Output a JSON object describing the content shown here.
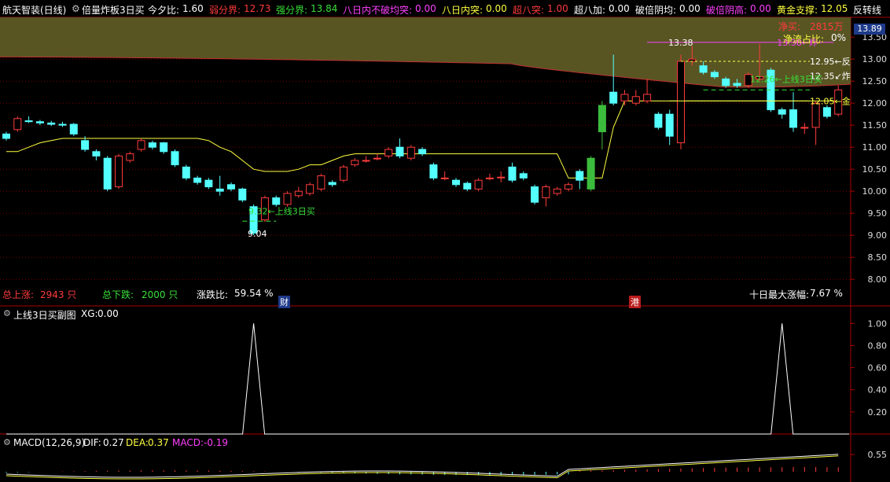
{
  "header": {
    "title": "航天智装(日线)",
    "indicator": "倍量炸板3日买",
    "items": [
      {
        "label": "今夕比:",
        "value": "1.60",
        "color": "#ffffff"
      },
      {
        "label": "弱分界:",
        "value": "12.73",
        "color": "#ff3b3b"
      },
      {
        "label": "强分界:",
        "value": "13.84",
        "color": "#38e038"
      },
      {
        "label": "八日内不破均突:",
        "value": "0.00",
        "color": "#ff40ff"
      },
      {
        "label": "八日内突:",
        "value": "0.00",
        "color": "#ffff40"
      },
      {
        "label": "超八突:",
        "value": "1.00",
        "color": "#ff3b3b"
      },
      {
        "label": "超八加:",
        "value": "0.00",
        "color": "#ffffff"
      },
      {
        "label": "破倍阴均:",
        "value": "0.00",
        "color": "#ffffff"
      },
      {
        "label": "破倍阴高:",
        "value": "0.00",
        "color": "#ff40ff"
      },
      {
        "label": "黄金支撑:",
        "value": "12.05",
        "color": "#ffff40"
      },
      {
        "label": "反转线",
        "value": "",
        "color": "#ffffff"
      }
    ]
  },
  "main_panel": {
    "net_buy_label": "净买:",
    "net_buy_value": "2815万",
    "net_flow_label": "净流占比:",
    "net_flow_value": "0%",
    "current_price_box": "13.89",
    "total_up_label": "总上涨:",
    "total_up_value": "2943 只",
    "total_down_label": "总下跌:",
    "total_down_value": "2000 只",
    "ratio_label": "涨跌比:",
    "ratio_value": "59.54 %",
    "ten_day_label": "十日最大涨幅:",
    "ten_day_value": "7.67 %",
    "marker_cai": "财",
    "marker_gang": "港"
  },
  "sub_panel": {
    "title": "上线3日买副图",
    "xg_label": "XG:",
    "xg_value": "0.00"
  },
  "macd_panel": {
    "title": "MACD(12,26,9)",
    "dif_label": "DIF:",
    "dif_value": "0.27",
    "dea_label": "DEA:",
    "dea_value": "0.37",
    "macd_label": "MACD:",
    "macd_value": "-0.19"
  },
  "chart_data": {
    "type": "candlestick",
    "y_ticks": [
      "13.50",
      "13.00",
      "12.50",
      "12.00",
      "11.50",
      "11.00",
      "10.50",
      "10.00",
      "9.50",
      "9.00",
      "8.50",
      "8.00"
    ],
    "ylim": [
      7.7,
      13.95
    ],
    "candles": [
      {
        "o": 11.3,
        "c": 11.2,
        "h": 11.35,
        "l": 11.15
      },
      {
        "o": 11.4,
        "c": 11.65,
        "h": 11.7,
        "l": 11.35
      },
      {
        "o": 11.6,
        "c": 11.58,
        "h": 11.7,
        "l": 11.55
      },
      {
        "o": 11.58,
        "c": 11.55,
        "h": 11.62,
        "l": 11.5
      },
      {
        "o": 11.55,
        "c": 11.52,
        "h": 11.6,
        "l": 11.48
      },
      {
        "o": 11.52,
        "c": 11.5,
        "h": 11.58,
        "l": 11.46
      },
      {
        "o": 11.52,
        "c": 11.3,
        "h": 11.55,
        "l": 11.25
      },
      {
        "o": 11.15,
        "c": 10.95,
        "h": 11.25,
        "l": 10.9
      },
      {
        "o": 10.9,
        "c": 10.8,
        "h": 10.95,
        "l": 10.7
      },
      {
        "o": 10.75,
        "c": 10.05,
        "h": 10.8,
        "l": 10.0
      },
      {
        "o": 10.1,
        "c": 10.8,
        "h": 10.85,
        "l": 10.05
      },
      {
        "o": 10.7,
        "c": 10.85,
        "h": 10.9,
        "l": 10.65
      },
      {
        "o": 10.95,
        "c": 11.15,
        "h": 11.2,
        "l": 10.9
      },
      {
        "o": 11.1,
        "c": 11.0,
        "h": 11.15,
        "l": 10.95
      },
      {
        "o": 11.1,
        "c": 10.9,
        "h": 11.12,
        "l": 10.85
      },
      {
        "o": 10.9,
        "c": 10.6,
        "h": 10.95,
        "l": 10.55
      },
      {
        "o": 10.55,
        "c": 10.3,
        "h": 10.6,
        "l": 10.25
      },
      {
        "o": 10.3,
        "c": 10.2,
        "h": 10.35,
        "l": 10.15
      },
      {
        "o": 10.25,
        "c": 10.1,
        "h": 10.3,
        "l": 10.05
      },
      {
        "o": 10.05,
        "c": 10.0,
        "h": 10.35,
        "l": 9.9
      },
      {
        "o": 10.15,
        "c": 10.05,
        "h": 10.2,
        "l": 10.0
      },
      {
        "o": 10.05,
        "c": 9.8,
        "h": 10.08,
        "l": 9.75
      },
      {
        "o": 9.65,
        "c": 9.05,
        "h": 9.7,
        "l": 9.0
      },
      {
        "o": 9.35,
        "c": 9.85,
        "h": 9.9,
        "l": 9.3
      },
      {
        "o": 9.85,
        "c": 9.7,
        "h": 9.9,
        "l": 9.65
      },
      {
        "o": 9.7,
        "c": 9.95,
        "h": 10.0,
        "l": 9.65
      },
      {
        "o": 9.9,
        "c": 10.0,
        "h": 10.1,
        "l": 9.85
      },
      {
        "o": 9.95,
        "c": 10.15,
        "h": 10.2,
        "l": 9.9
      },
      {
        "o": 10.05,
        "c": 10.35,
        "h": 10.4,
        "l": 10.0
      },
      {
        "o": 10.2,
        "c": 10.15,
        "h": 10.25,
        "l": 10.1
      },
      {
        "o": 10.25,
        "c": 10.55,
        "h": 10.6,
        "l": 10.2
      },
      {
        "o": 10.6,
        "c": 10.7,
        "h": 10.75,
        "l": 10.55
      },
      {
        "o": 10.7,
        "c": 10.7,
        "h": 10.8,
        "l": 10.65
      },
      {
        "o": 10.75,
        "c": 10.75,
        "h": 10.85,
        "l": 10.7
      },
      {
        "o": 10.8,
        "c": 10.95,
        "h": 11.0,
        "l": 10.75
      },
      {
        "o": 11.0,
        "c": 10.8,
        "h": 11.2,
        "l": 10.75
      },
      {
        "o": 10.75,
        "c": 11.0,
        "h": 11.05,
        "l": 10.7
      },
      {
        "o": 10.95,
        "c": 10.85,
        "h": 11.0,
        "l": 10.8
      },
      {
        "o": 10.6,
        "c": 10.3,
        "h": 10.65,
        "l": 10.25
      },
      {
        "o": 10.3,
        "c": 10.3,
        "h": 10.45,
        "l": 10.25
      },
      {
        "o": 10.25,
        "c": 10.15,
        "h": 10.3,
        "l": 10.1
      },
      {
        "o": 10.18,
        "c": 10.05,
        "h": 10.22,
        "l": 10.0
      },
      {
        "o": 10.05,
        "c": 10.25,
        "h": 10.3,
        "l": 10.0
      },
      {
        "o": 10.3,
        "c": 10.3,
        "h": 10.4,
        "l": 10.25
      },
      {
        "o": 10.32,
        "c": 10.32,
        "h": 10.45,
        "l": 10.2
      },
      {
        "o": 10.55,
        "c": 10.25,
        "h": 10.65,
        "l": 10.2
      },
      {
        "o": 10.4,
        "c": 10.3,
        "h": 10.45,
        "l": 10.25
      },
      {
        "o": 10.1,
        "c": 9.75,
        "h": 10.15,
        "l": 9.7
      },
      {
        "o": 9.85,
        "c": 10.1,
        "h": 10.15,
        "l": 9.65
      },
      {
        "o": 9.95,
        "c": 10.05,
        "h": 10.1,
        "l": 9.9
      },
      {
        "o": 10.05,
        "c": 10.15,
        "h": 10.2,
        "l": 10.0
      },
      {
        "o": 10.45,
        "c": 10.25,
        "h": 10.5,
        "l": 10.05
      },
      {
        "o": 10.75,
        "c": 10.05,
        "h": 10.8,
        "l": 10.0
      },
      {
        "o": 11.35,
        "c": 11.95,
        "h": 12.05,
        "l": 10.95
      },
      {
        "o": 12.25,
        "c": 12.0,
        "h": 13.1,
        "l": 11.95
      },
      {
        "o": 12.05,
        "c": 12.2,
        "h": 12.3,
        "l": 11.95
      },
      {
        "o": 12.0,
        "c": 12.15,
        "h": 12.3,
        "l": 11.95
      },
      {
        "o": 12.05,
        "c": 12.2,
        "h": 12.55,
        "l": 12.0
      },
      {
        "o": 11.75,
        "c": 11.45,
        "h": 11.8,
        "l": 11.4
      },
      {
        "o": 11.75,
        "c": 11.25,
        "h": 11.85,
        "l": 11.05
      },
      {
        "o": 11.1,
        "c": 12.95,
        "h": 13.1,
        "l": 10.95
      },
      {
        "o": 12.95,
        "c": 13.0,
        "h": 13.3,
        "l": 12.85
      },
      {
        "o": 12.85,
        "c": 12.7,
        "h": 12.95,
        "l": 12.65
      },
      {
        "o": 12.7,
        "c": 12.6,
        "h": 12.75,
        "l": 12.55
      },
      {
        "o": 12.55,
        "c": 12.4,
        "h": 12.6,
        "l": 12.35
      },
      {
        "o": 12.45,
        "c": 12.4,
        "h": 12.55,
        "l": 12.35
      },
      {
        "o": 12.4,
        "c": 12.65,
        "h": 12.7,
        "l": 12.35
      },
      {
        "o": 12.55,
        "c": 12.6,
        "h": 13.35,
        "l": 12.5
      },
      {
        "o": 12.75,
        "c": 11.85,
        "h": 12.8,
        "l": 11.8
      },
      {
        "o": 11.85,
        "c": 11.75,
        "h": 11.9,
        "l": 11.65
      },
      {
        "o": 11.85,
        "c": 11.45,
        "h": 12.25,
        "l": 11.35
      },
      {
        "o": 11.45,
        "c": 11.45,
        "h": 11.55,
        "l": 11.3
      },
      {
        "o": 11.45,
        "c": 12.0,
        "h": 12.05,
        "l": 11.05
      },
      {
        "o": 11.9,
        "c": 11.7,
        "h": 11.95,
        "l": 11.65
      },
      {
        "o": 11.75,
        "c": 12.3,
        "h": 12.4,
        "l": 11.7
      }
    ],
    "filled_green_indices": [
      52,
      53
    ],
    "yellow_line": [
      10.9,
      10.9,
      11.0,
      11.1,
      11.15,
      11.2,
      11.2,
      11.2,
      11.2,
      11.2,
      11.2,
      11.2,
      11.2,
      11.2,
      11.2,
      11.2,
      11.2,
      11.2,
      11.15,
      11.0,
      10.9,
      10.7,
      10.5,
      10.45,
      10.45,
      10.45,
      10.5,
      10.6,
      10.6,
      10.7,
      10.8,
      10.85,
      10.85,
      10.85,
      10.85,
      10.85,
      10.85,
      10.85,
      10.85,
      10.85,
      10.85,
      10.85,
      10.85,
      10.85,
      10.85,
      10.85,
      10.85,
      10.85,
      10.85,
      10.85,
      10.3,
      10.3,
      10.3,
      10.3,
      11.45,
      12.05,
      12.05,
      12.05,
      12.05,
      12.05,
      12.05,
      12.05,
      12.05,
      12.05,
      12.05,
      12.05,
      12.05,
      12.05,
      12.05,
      12.05,
      12.05,
      12.05,
      12.05,
      12.05,
      12.05
    ],
    "labels": [
      {
        "text": "13.38←炸",
        "price": 13.38,
        "color": "#ff40ff"
      },
      {
        "text": "12.95←反",
        "price": 12.95,
        "color": "#ffffff"
      },
      {
        "text": "12.35↙炸",
        "price": 12.62,
        "color": "#ffffff"
      },
      {
        "text": "12.26←上线3日买",
        "price": 12.55,
        "color": "#38e038"
      },
      {
        "text": "12.05←金",
        "price": 12.05,
        "color": "#ffff40"
      },
      {
        "text": "9.32←上线3日买",
        "price": 9.55,
        "color": "#38e038"
      },
      {
        "text": "9.04",
        "price": 9.04,
        "color": "#ffffff"
      },
      {
        "text": "13.38",
        "price": 13.38,
        "color": "#ffffff"
      }
    ],
    "sub_ticks": [
      "1.00",
      "0.80",
      "0.60",
      "0.40",
      "0.20"
    ],
    "xg_spikes": [
      22,
      69
    ],
    "macd_tick": "0.55"
  }
}
